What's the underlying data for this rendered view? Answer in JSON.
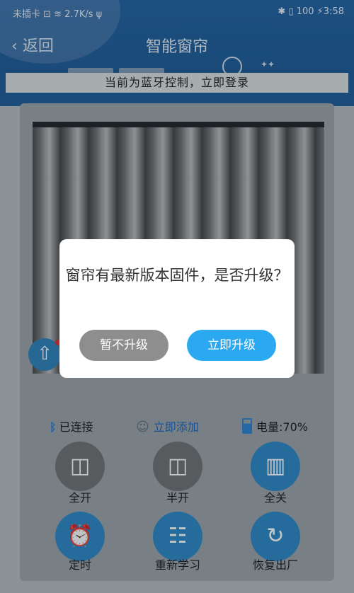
{
  "status_bar": {
    "left": "未插卡 ⊡ ≋ 2.7K/s ψ",
    "right": "✱ ▯ 100 ⚡3:58"
  },
  "header": {
    "back_label": "返回",
    "title": "智能窗帘",
    "banner": "当前为蓝牙控制，立即登录"
  },
  "dialog": {
    "message": "窗帘有最新版本固件，是否升级？",
    "cancel_label": "暂不升级",
    "confirm_label": "立即升级"
  },
  "info": {
    "connection": "已连接",
    "add_label": "立即添加",
    "battery": "电量:70%",
    "battery_level": 0.7
  },
  "controls": {
    "row1": [
      {
        "label": "全开",
        "icon": "curtain-full-open-icon"
      },
      {
        "label": "半开",
        "icon": "curtain-half-open-icon"
      },
      {
        "label": "全关",
        "icon": "curtain-close-icon"
      }
    ],
    "row2": [
      {
        "label": "定时",
        "icon": "alarm-clock-icon"
      },
      {
        "label": "重新学习",
        "icon": "book-icon"
      },
      {
        "label": "恢复出厂",
        "icon": "refresh-icon"
      }
    ]
  },
  "colors": {
    "accent": "#2aa8f0",
    "header": "#1f5f9e"
  }
}
